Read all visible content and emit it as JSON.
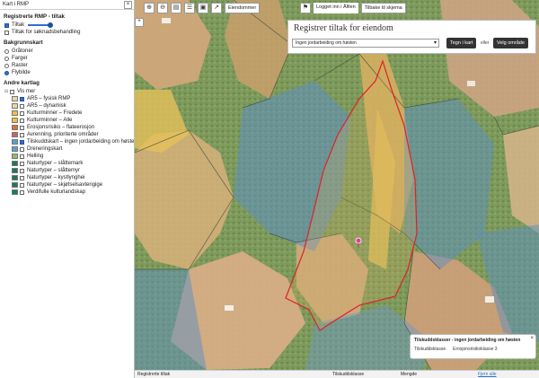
{
  "sidebar": {
    "title": "Kart i RMP",
    "close": "×",
    "rmp_section": "Registrerte RMP - tiltak",
    "rmp_items": [
      {
        "label": "Tiltak",
        "checked": true,
        "slider": true
      },
      {
        "label": "Tiltak for søknadsbehandling",
        "checked": false
      }
    ],
    "bakgrunn_section": "Bakgrunnskart",
    "bakgrunn_items": [
      {
        "label": "Gråtoner",
        "selected": false
      },
      {
        "label": "Farger",
        "selected": false
      },
      {
        "label": "Raster",
        "selected": false
      },
      {
        "label": "Flybilde",
        "selected": true
      }
    ],
    "andre_section": "Andre kartlag",
    "vis_mer": "Vis mer",
    "layers": [
      {
        "label": "AR5 – fysisk RMP",
        "checked": true,
        "swatch": "#e8d8a8"
      },
      {
        "label": "AR5 – dynamisk",
        "checked": false,
        "swatch": "#e8d8a8"
      },
      {
        "label": "Kulturminner – Fredete",
        "checked": false,
        "swatch": "#f0c040"
      },
      {
        "label": "Kulturminner – Alle",
        "checked": false,
        "swatch": "#f0c040"
      },
      {
        "label": "Erosjonsrisiko – flateerosjon",
        "checked": false,
        "swatch": "#e07030"
      },
      {
        "label": "Avrenning, prioriterte områder",
        "checked": false,
        "swatch": "#d06060"
      },
      {
        "label": "Tilskuddskart – ingen jordarbeiding om høsten",
        "checked": true,
        "swatch": "#5aa0d0"
      },
      {
        "label": "Dreneringskart",
        "checked": false,
        "swatch": "#5aa0d0"
      },
      {
        "label": "Helling",
        "checked": false,
        "swatch": "#90c060"
      },
      {
        "label": "Naturtyper – slåttemark",
        "checked": false,
        "swatch": "#1a7a5a"
      },
      {
        "label": "Naturtyper – slåttemyr",
        "checked": false,
        "swatch": "#1a7a5a"
      },
      {
        "label": "Naturtyper – kystlynghei",
        "checked": false,
        "swatch": "#1a7a5a"
      },
      {
        "label": "Naturtyper – skjøtselsavtengige",
        "checked": false,
        "swatch": "#1a7a5a"
      },
      {
        "label": "Verdifulle kulturlandskap",
        "checked": false,
        "swatch": "#1a7a5a"
      }
    ]
  },
  "toolbar": {
    "eiendommer": "Eiendommer",
    "logged_in": "Logget inn i Ålfien",
    "back": "Tilbake til skjema"
  },
  "panel": {
    "title": "Registrer tiltak for eiendom",
    "select_value": "Ingen jordarbeiding om høsten",
    "btn_kart": "Tegn i kart",
    "eller": "eller",
    "btn_omrade": "Velg område"
  },
  "popup": {
    "title": "Tilskuddsklasser - ingen jordarbeiding om høsten",
    "label": "Tilskuddsklasse",
    "value": "Erosjonsrisikoklasse 3",
    "close": "×"
  },
  "bottombar": {
    "col1": "Registrerte tiltak",
    "col2": "Tilskuddsklasse",
    "col3": "Mengde",
    "col4": "Fjern alle"
  },
  "colors": {
    "accent": "#2f6fd0",
    "dark_button": "#333333",
    "outline_red": "#e0202a"
  }
}
